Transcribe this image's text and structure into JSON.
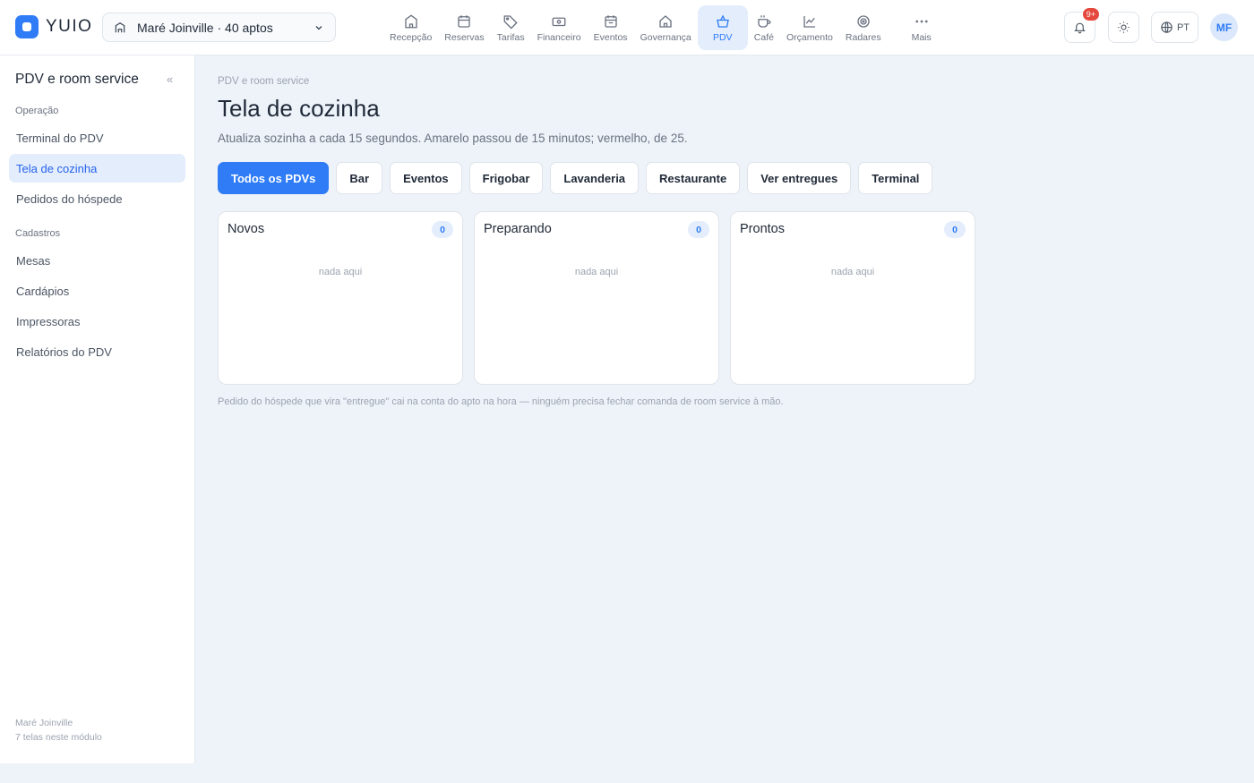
{
  "app": {
    "brand": "YUIO"
  },
  "property": {
    "label": "Maré Joinville · 40 aptos"
  },
  "nav": [
    {
      "label": "Recepção",
      "icon": "building-icon"
    },
    {
      "label": "Reservas",
      "icon": "calendar-icon"
    },
    {
      "label": "Tarifas",
      "icon": "tag-icon"
    },
    {
      "label": "Financeiro",
      "icon": "banknote-icon"
    },
    {
      "label": "Eventos",
      "icon": "calendar-event-icon"
    },
    {
      "label": "Governança",
      "icon": "home-icon"
    },
    {
      "label": "PDV",
      "icon": "basket-icon",
      "active": true
    },
    {
      "label": "Café",
      "icon": "coffee-icon"
    },
    {
      "label": "Orçamento",
      "icon": "chart-line-icon"
    },
    {
      "label": "Radares",
      "icon": "target-icon"
    },
    {
      "label": "Mais",
      "icon": "more-icon"
    }
  ],
  "header": {
    "notif_badge": "9+",
    "lang": "PT",
    "avatar": "MF"
  },
  "sidebar": {
    "title": "PDV e room service",
    "collapse": "«",
    "sections": [
      {
        "label": "Operação",
        "items": [
          "Terminal do PDV",
          "Tela de cozinha",
          "Pedidos do hóspede"
        ]
      },
      {
        "label": "Cadastros",
        "items": [
          "Mesas",
          "Cardápios",
          "Impressoras",
          "Relatórios do PDV"
        ]
      }
    ],
    "footer": {
      "line1": "Maré Joinville",
      "line2": "7 telas neste módulo"
    }
  },
  "main": {
    "breadcrumb": "PDV e room service",
    "title": "Tela de cozinha",
    "subtitle": "Atualiza sozinha a cada 15 segundos. Amarelo passou de 15 minutos; vermelho, de 25.",
    "filters": [
      "Todos os PDVs",
      "Bar",
      "Eventos",
      "Frigobar",
      "Lavanderia",
      "Restaurante",
      "Ver entregues",
      "Terminal"
    ],
    "columns": [
      {
        "title": "Novos",
        "count": "0",
        "empty": "nada aqui"
      },
      {
        "title": "Preparando",
        "count": "0",
        "empty": "nada aqui"
      },
      {
        "title": "Prontos",
        "count": "0",
        "empty": "nada aqui"
      }
    ],
    "footnote": "Pedido do hóspede que vira \"entregue\" cai na conta do apto na hora — ninguém precisa fechar comanda de room service à mão."
  },
  "colors": {
    "accent": "#2f7cf6",
    "accent_soft": "#e3edfc",
    "badge": "#e5483d",
    "background": "#eef3fa"
  }
}
